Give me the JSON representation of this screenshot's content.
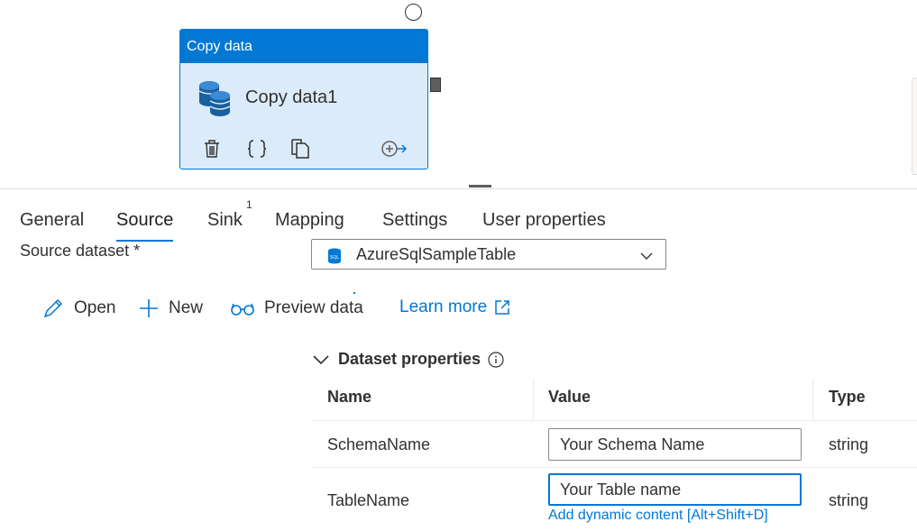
{
  "activity": {
    "header": "Copy data",
    "name": "Copy data1",
    "icons": [
      "delete-icon",
      "code-icon",
      "clone-icon",
      "add-output-icon"
    ]
  },
  "tabs": [
    {
      "label": "General"
    },
    {
      "label": "Source",
      "active": true
    },
    {
      "label": "Sink",
      "badge": "1"
    },
    {
      "label": "Mapping"
    },
    {
      "label": "Settings"
    },
    {
      "label": "User properties"
    }
  ],
  "source": {
    "dataset_label": "Source dataset *",
    "dataset_value": "AzureSqlSampleTable"
  },
  "toolbar": {
    "open": "Open",
    "new": "New",
    "preview": "Preview data",
    "learn_more": "Learn more"
  },
  "dataset_properties": {
    "title": "Dataset properties",
    "columns": [
      "Name",
      "Value",
      "Type"
    ],
    "rows": [
      {
        "name": "SchemaName",
        "value": "Your Schema Name",
        "type": "string"
      },
      {
        "name": "TableName",
        "value": "Your Table name",
        "type": "string",
        "link": "Add dynamic content [Alt+Shift+D]"
      }
    ]
  },
  "colors": {
    "accent": "#0078d4",
    "activity_bg": "#dcebf9",
    "text": "#323130"
  }
}
